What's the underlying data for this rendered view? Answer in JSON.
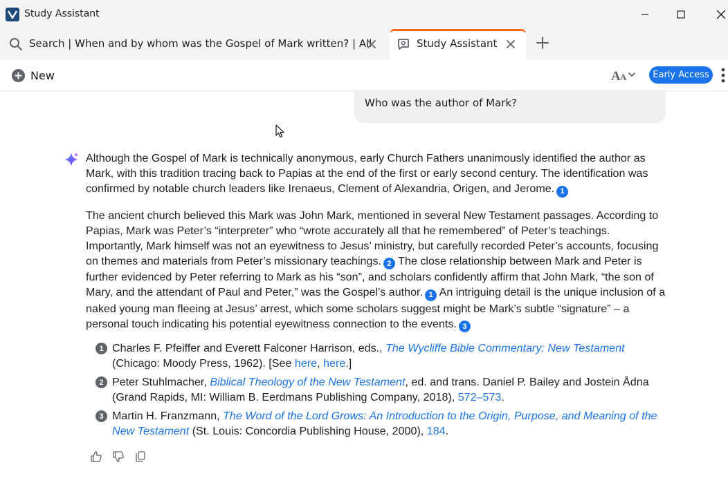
{
  "window": {
    "title": "Study Assistant"
  },
  "tabs": [
    {
      "label": "Search | When and by whom was the Gospel of Mark written? | All",
      "active": false
    },
    {
      "label": "Study Assistant",
      "active": true
    }
  ],
  "toolbar": {
    "new_label": "New",
    "early_access_label": "Early Access"
  },
  "chat": {
    "user_message": "Who was the author of Mark?",
    "answer": {
      "p1": {
        "text": "Although the Gospel of Mark is technically anonymous, early Church Fathers unanimously identified the author as Mark, with this tradition tracing back to Papias at the end of the first or early second century. The identification was confirmed by notable church leaders like Irenaeus, Clement of Alexandria, Origen, and Jerome.",
        "cite": "1"
      },
      "p2": {
        "s1": "The ancient church believed this Mark was John Mark, mentioned in several New Testament passages. According to Papias, Mark was Peter’s “interpreter” who “wrote accurately all that he remembered” of Peter’s teachings. Importantly, Mark himself was not an eyewitness to Jesus’ ministry, but carefully recorded Peter’s accounts, focusing on themes and materials from Peter’s missionary teachings.",
        "c1": "2",
        "s2": " The close relationship between Mark and Peter is further evidenced by Peter referring to Mark as his “son”, and scholars confidently affirm that John Mark, “the son of Mary, and the attendant of Paul and Peter,” was the Gospel’s author.",
        "c2": "1",
        "s3": " An intriguing detail is the unique inclusion of a naked young man fleeing at Jesus’ arrest, which some scholars suggest might be Mark’s subtle “signature” – a personal touch indicating his potential eyewitness connection to the events.",
        "c3": "3"
      }
    },
    "references": [
      {
        "num": "1",
        "before": "Charles F. Pfeiffer and Everett Falconer Harrison, eds., ",
        "title": "The Wycliffe Bible Commentary: New Testament",
        "after": " (Chicago: Moody Press, 1962). [See ",
        "link1": "here",
        "sep": ", ",
        "link2": "here",
        "end": ".]"
      },
      {
        "num": "2",
        "before": "Peter Stuhlmacher, ",
        "title": "Biblical Theology of the New Testament",
        "after": ", ed. and trans. Daniel P. Bailey and Jostein Ådna (Grand Rapids, MI: William B. Eerdmans Publishing Company, 2018), ",
        "link1": "572–573",
        "end": "."
      },
      {
        "num": "3",
        "before": "Martin H. Franzmann, ",
        "title": "The Word of the Lord Grows: An Introduction to the Origin, Purpose, and Meaning of the New Testament",
        "after": " (St. Louis: Concordia Publishing House, 2000), ",
        "link1": "184",
        "end": "."
      }
    ]
  },
  "icons": {
    "app": "app-logo-icon",
    "search_tab": "search-icon",
    "assistant_tab": "study-assistant-icon",
    "new": "plus-circle-icon",
    "font_size": "font-size-icon",
    "more": "more-vertical-icon",
    "sparkle": "sparkle-icon",
    "thumbs_up": "thumbs-up-icon",
    "thumbs_down": "thumbs-down-icon",
    "copy": "copy-icon"
  },
  "colors": {
    "accent": "#1a73e8",
    "active_tab_indicator": "#f26a1b",
    "bubble": "#eef0f2",
    "chrome": "#f3f3f3"
  }
}
